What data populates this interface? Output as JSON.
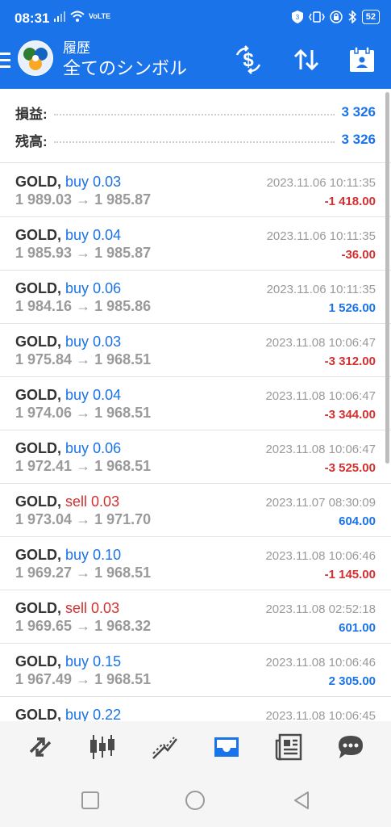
{
  "status_bar": {
    "time": "08:31",
    "network": "VoLTE",
    "battery": "52"
  },
  "header": {
    "subtitle": "履歴",
    "title": "全てのシンボル",
    "icons": [
      "menu-icon",
      "metatrader-logo",
      "currency-dollar-icon",
      "sort-icon",
      "calendar-icon"
    ]
  },
  "summary": {
    "profit_label": "損益:",
    "profit_value": "3 326",
    "balance_label": "残高:",
    "balance_value": "3 326"
  },
  "trades": [
    {
      "symbol": "GOLD,",
      "side": "buy",
      "volume": "0.03",
      "open": "1 989.03",
      "close": "1 985.87",
      "time": "2023.11.06 10:11:35",
      "profit": "-1 418.00"
    },
    {
      "symbol": "GOLD,",
      "side": "buy",
      "volume": "0.04",
      "open": "1 985.93",
      "close": "1 985.87",
      "time": "2023.11.06 10:11:35",
      "profit": "-36.00"
    },
    {
      "symbol": "GOLD,",
      "side": "buy",
      "volume": "0.06",
      "open": "1 984.16",
      "close": "1 985.86",
      "time": "2023.11.06 10:11:35",
      "profit": "1 526.00"
    },
    {
      "symbol": "GOLD,",
      "side": "buy",
      "volume": "0.03",
      "open": "1 975.84",
      "close": "1 968.51",
      "time": "2023.11.08 10:06:47",
      "profit": "-3 312.00"
    },
    {
      "symbol": "GOLD,",
      "side": "buy",
      "volume": "0.04",
      "open": "1 974.06",
      "close": "1 968.51",
      "time": "2023.11.08 10:06:47",
      "profit": "-3 344.00"
    },
    {
      "symbol": "GOLD,",
      "side": "buy",
      "volume": "0.06",
      "open": "1 972.41",
      "close": "1 968.51",
      "time": "2023.11.08 10:06:47",
      "profit": "-3 525.00"
    },
    {
      "symbol": "GOLD,",
      "side": "sell",
      "volume": "0.03",
      "open": "1 973.04",
      "close": "1 971.70",
      "time": "2023.11.07 08:30:09",
      "profit": "604.00"
    },
    {
      "symbol": "GOLD,",
      "side": "buy",
      "volume": "0.10",
      "open": "1 969.27",
      "close": "1 968.51",
      "time": "2023.11.08 10:06:46",
      "profit": "-1 145.00"
    },
    {
      "symbol": "GOLD,",
      "side": "sell",
      "volume": "0.03",
      "open": "1 969.65",
      "close": "1 968.32",
      "time": "2023.11.08 02:52:18",
      "profit": "601.00"
    },
    {
      "symbol": "GOLD,",
      "side": "buy",
      "volume": "0.15",
      "open": "1 967.49",
      "close": "1 968.51",
      "time": "2023.11.08 10:06:46",
      "profit": "2 305.00"
    },
    {
      "symbol": "GOLD,",
      "side": "buy",
      "volume": "0.22",
      "open": "",
      "close": "",
      "time": "2023.11.08 10:06:45",
      "profit": ""
    }
  ],
  "arrow": "→",
  "colors": {
    "accent": "#1a73e8",
    "buy": "#1a73e8",
    "sell": "#d32f2f",
    "profit_positive": "#1a73e8",
    "profit_negative": "#d32f2f",
    "muted": "#9a9a9a"
  },
  "tabs": [
    {
      "name": "tab-quotes",
      "icon": "arrows-diagonal-icon",
      "active": false
    },
    {
      "name": "tab-chart",
      "icon": "candlestick-icon",
      "active": false
    },
    {
      "name": "tab-trade",
      "icon": "trend-icon",
      "active": false
    },
    {
      "name": "tab-history",
      "icon": "inbox-icon",
      "active": true
    },
    {
      "name": "tab-news",
      "icon": "newspaper-icon",
      "active": false
    },
    {
      "name": "tab-messages",
      "icon": "chat-icon",
      "active": false
    }
  ],
  "system_nav": [
    "recents-square-icon",
    "home-circle-icon",
    "back-triangle-icon"
  ]
}
